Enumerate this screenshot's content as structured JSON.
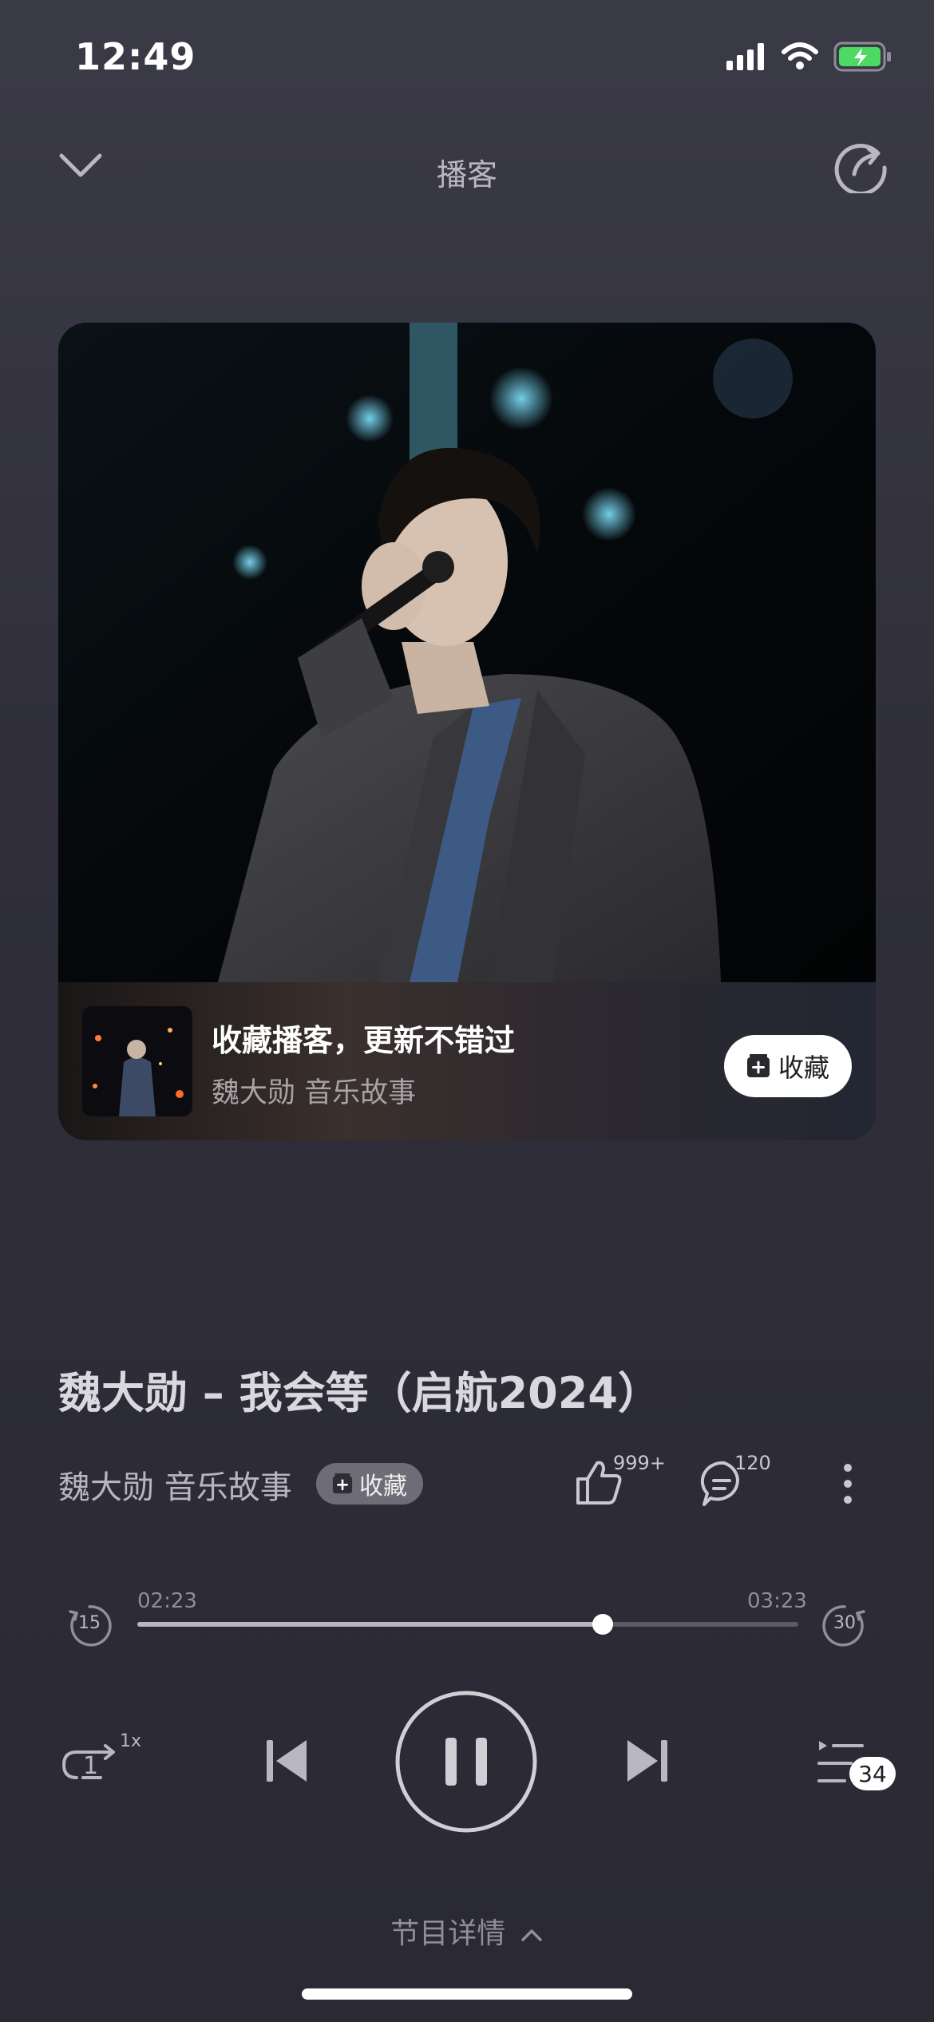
{
  "status_bar": {
    "time": "12:49"
  },
  "header": {
    "title": "播客"
  },
  "promo": {
    "title": "收藏播客，更新不错过",
    "subtitle": "魏大勋 音乐故事",
    "button_label": "收藏"
  },
  "track": {
    "title": "魏大勋 – 我会等（启航2024）",
    "podcast_name": "魏大勋 音乐故事",
    "collect_label": "收藏",
    "likes": "999+",
    "comments": "120"
  },
  "progress": {
    "current": "02:23",
    "total": "03:23",
    "fraction": 0.704,
    "rewind_seconds": "15",
    "forward_seconds": "30"
  },
  "controls": {
    "repeat_count": "1",
    "speed": "1x",
    "queue_count": "34"
  },
  "footer": {
    "details_label": "节目详情"
  },
  "colors": {
    "background": "#2f2e3a",
    "accent_white": "#ffffff",
    "muted": "#8f8e99"
  }
}
